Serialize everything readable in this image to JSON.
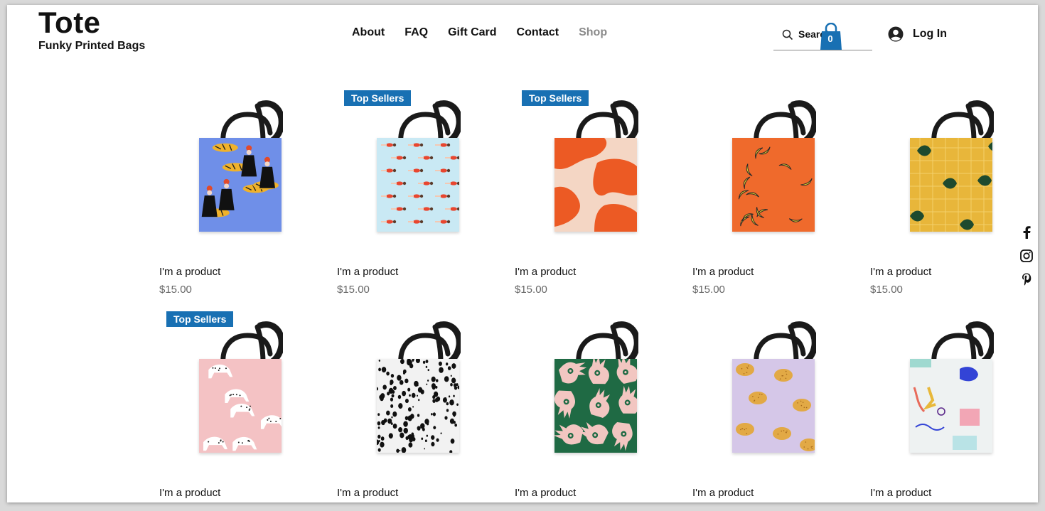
{
  "brand": {
    "title": "Tote",
    "subtitle": "Funky Printed Bags"
  },
  "nav": {
    "items": [
      {
        "label": "About",
        "name": "nav-about"
      },
      {
        "label": "FAQ",
        "name": "nav-faq"
      },
      {
        "label": "Gift Card",
        "name": "nav-gift-card"
      },
      {
        "label": "Contact",
        "name": "nav-contact"
      },
      {
        "label": "Shop",
        "name": "nav-shop",
        "current": true
      }
    ]
  },
  "search": {
    "label": "Search",
    "icon": "search-icon"
  },
  "cart": {
    "count": "0",
    "icon": "shopping-bag-icon",
    "color": "#1870b3"
  },
  "account": {
    "label": "Log In",
    "icon": "user-avatar-icon"
  },
  "social": [
    "facebook-icon",
    "instagram-icon",
    "pinterest-icon"
  ],
  "colors": {
    "accent": "#1870b3",
    "price": "#666666",
    "nav_dim": "#8a8a8a"
  },
  "products": [
    {
      "name": "I'm a product",
      "price": "$15.00",
      "badge": "",
      "pattern": "blue-tigers-women",
      "base": "#6f8fe8"
    },
    {
      "name": "I'm a product",
      "price": "$15.00",
      "badge": "Top Sellers",
      "pattern": "light-blue-swimmers",
      "base": "#c9e9f4"
    },
    {
      "name": "I'm a product",
      "price": "$15.00",
      "badge": "Top Sellers",
      "pattern": "orange-abstract",
      "base": "#f4d6c4"
    },
    {
      "name": "I'm a product",
      "price": "$15.00",
      "badge": "",
      "pattern": "orange-bananas",
      "base": "#ef6a2c"
    },
    {
      "name": "I'm a product",
      "price": "$15.00",
      "badge": "",
      "pattern": "yellow-leaves-grid",
      "base": "#e8b63a"
    },
    {
      "name": "I'm a product",
      "price": "",
      "badge": "Top Sellers",
      "pattern": "pink-leopards",
      "base": "#f4c2c4"
    },
    {
      "name": "I'm a product",
      "price": "",
      "badge": "",
      "pattern": "white-black-spots",
      "base": "#f2f2f2"
    },
    {
      "name": "I'm a product",
      "price": "",
      "badge": "",
      "pattern": "green-hands",
      "base": "#1f6a44"
    },
    {
      "name": "I'm a product",
      "price": "",
      "badge": "",
      "pattern": "lilac-lemons",
      "base": "#d5c7e8"
    },
    {
      "name": "I'm a product",
      "price": "",
      "badge": "",
      "pattern": "pastel-brush-strokes",
      "base": "#eef2f2"
    }
  ]
}
